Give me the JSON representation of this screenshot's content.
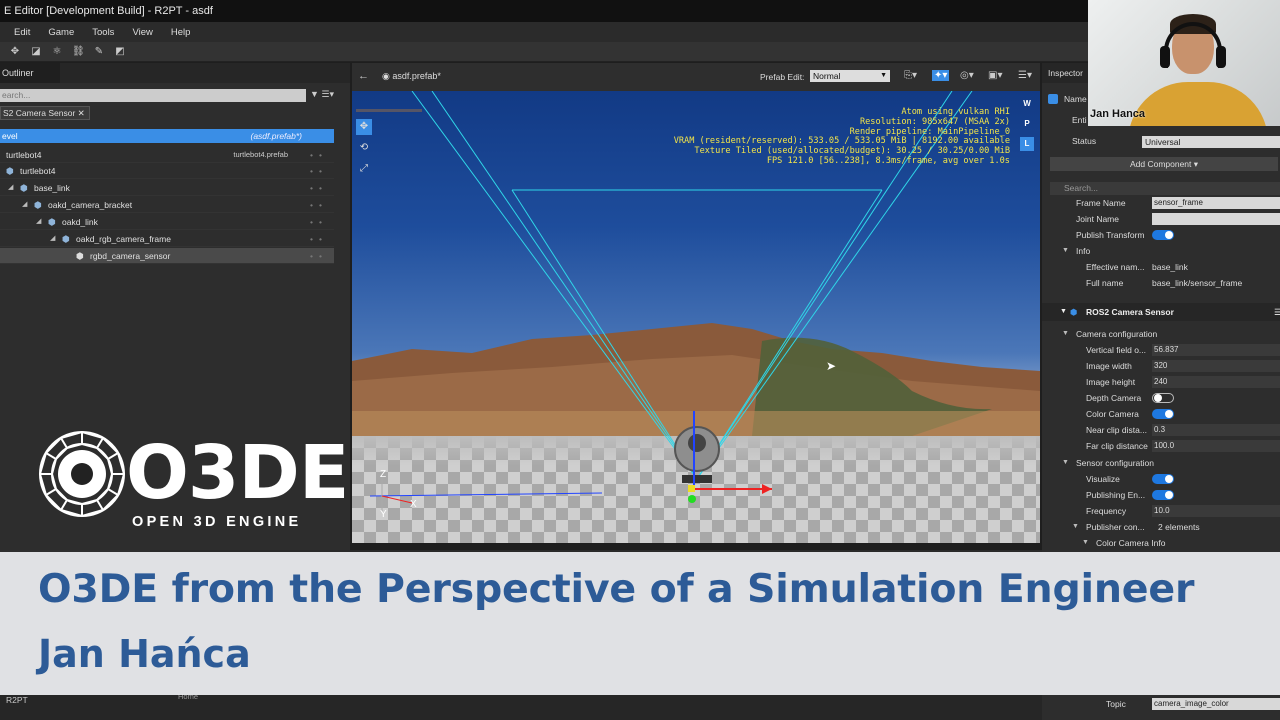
{
  "window": {
    "title": "E Editor [Development Build] - R2PT - asdf"
  },
  "menu": {
    "items": [
      "Edit",
      "Game",
      "Tools",
      "View",
      "Help"
    ]
  },
  "outliner": {
    "tab": "Outliner",
    "search_placeholder": "earch...",
    "chip": "S2 Camera Sensor",
    "level_label": "evel",
    "level_prefab": "(asdf.prefab*)",
    "rows": [
      {
        "name": "turtlebot4",
        "prefab": "turtlebot4.prefab"
      },
      {
        "name": "turtlebot4"
      },
      {
        "name": "base_link"
      },
      {
        "name": "oakd_camera_bracket"
      },
      {
        "name": "oakd_link"
      },
      {
        "name": "oakd_rgb_camera_frame"
      },
      {
        "name": "rgbd_camera_sensor"
      }
    ]
  },
  "viewport": {
    "file": "asdf.prefab*",
    "prefab_edit_label": "Prefab Edit:",
    "prefab_edit_value": "Normal",
    "overlay": [
      "Atom using vulkan RHI",
      "Resolution: 985x647 (MSAA 2x)",
      "Render pipeline: MainPipeline_0",
      "VRAM (resident/reserved): 533.05 / 533.05 MiB | 8192.00 available",
      "Texture Tiled (used/allocated/budget): 30.25 / 30.25/0.00 MiB",
      "FPS 121.0 [56..238], 8.3ms/frame, avg over 1.0s"
    ],
    "modes": [
      "W",
      "P",
      "L"
    ],
    "axes": {
      "z": "Z",
      "x": "X",
      "y": "Y"
    }
  },
  "inspector": {
    "tab": "Inspector",
    "name_label": "Name",
    "entity_label": "Enti",
    "status_label": "Status",
    "status_value": "Universal",
    "add_component": "Add Component ▾",
    "search_placeholder": "Search...",
    "frame_name": {
      "label": "Frame Name",
      "value": "sensor_frame"
    },
    "joint_name": {
      "label": "Joint Name",
      "value": ""
    },
    "publish_transform": "Publish Transform",
    "info": "Info",
    "effective_name": {
      "label": "Effective nam...",
      "value": "base_link"
    },
    "full_name": {
      "label": "Full name",
      "value": "base_link/sensor_frame"
    },
    "component": "ROS2 Camera Sensor",
    "camera_config": "Camera configuration",
    "vfov": {
      "label": "Vertical field o...",
      "value": "56.837"
    },
    "width": {
      "label": "Image width",
      "value": "320"
    },
    "height": {
      "label": "Image height",
      "value": "240"
    },
    "depth_camera": "Depth Camera",
    "color_camera": "Color Camera",
    "near_clip": {
      "label": "Near clip dista...",
      "value": "0.3"
    },
    "far_clip": {
      "label": "Far clip distance",
      "value": "100.0"
    },
    "sensor_config": "Sensor configuration",
    "visualize": "Visualize",
    "publishing": "Publishing En...",
    "frequency": {
      "label": "Frequency",
      "value": "10.0"
    },
    "publisher": {
      "label": "Publisher con...",
      "value": "2 elements"
    },
    "color_camera_info": "Color Camera Info",
    "topic": {
      "label": "Topic",
      "value": "camera_image_color"
    }
  },
  "webcam": {
    "name": "Jan Hanca"
  },
  "logo": {
    "text": "O3DE",
    "sub": "OPEN 3D ENGINE"
  },
  "banner": {
    "title": "O3DE from the Perspective of a Simulation Engineer",
    "name": "Jan Hańca"
  },
  "statusbar": {
    "project": "R2PT",
    "home": "Home"
  }
}
